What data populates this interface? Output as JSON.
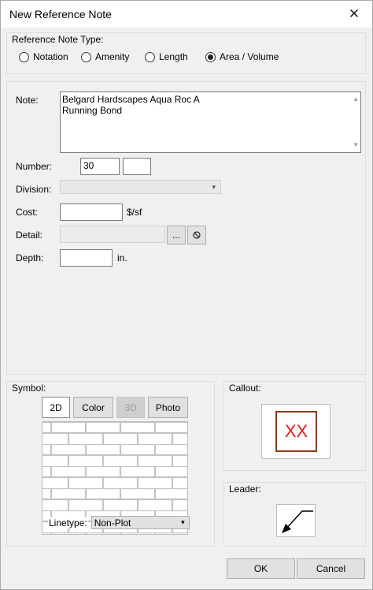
{
  "window": {
    "title": "New Reference Note"
  },
  "note_type": {
    "label": "Reference Note Type:",
    "options": [
      {
        "label": "Notation",
        "selected": false
      },
      {
        "label": "Amenity",
        "selected": false
      },
      {
        "label": "Length",
        "selected": false
      },
      {
        "label": "Area / Volume",
        "selected": true
      }
    ]
  },
  "fields": {
    "note_label": "Note:",
    "note_line1": "Belgard Hardscapes Aqua Roc A",
    "note_line2": "Running Bond",
    "number_label": "Number:",
    "number_value": "30",
    "number_suffix": "",
    "division_label": "Division:",
    "division_value": "",
    "cost_label": "Cost:",
    "cost_value": "",
    "cost_unit": "$/sf",
    "detail_label": "Detail:",
    "detail_value": "",
    "detail_browse": "...",
    "depth_label": "Depth:",
    "depth_value": "",
    "depth_unit": "in."
  },
  "symbol": {
    "label": "Symbol:",
    "tabs": [
      {
        "label": "2D",
        "state": "active"
      },
      {
        "label": "Color",
        "state": "normal"
      },
      {
        "label": "3D",
        "state": "disabled"
      },
      {
        "label": "Photo",
        "state": "normal"
      }
    ],
    "linetype_label": "Linetype:",
    "linetype_value": "Non-Plot"
  },
  "callout": {
    "label": "Callout:",
    "text": "XX",
    "color": "#e02020",
    "border_color": "#8b3a1a"
  },
  "leader": {
    "label": "Leader:"
  },
  "buttons": {
    "ok": "OK",
    "cancel": "Cancel"
  },
  "icons": {
    "close": "close-icon",
    "clear": "no-entry-icon",
    "dropdown": "chevron-down-icon",
    "leader": "leader-arrow-icon"
  }
}
